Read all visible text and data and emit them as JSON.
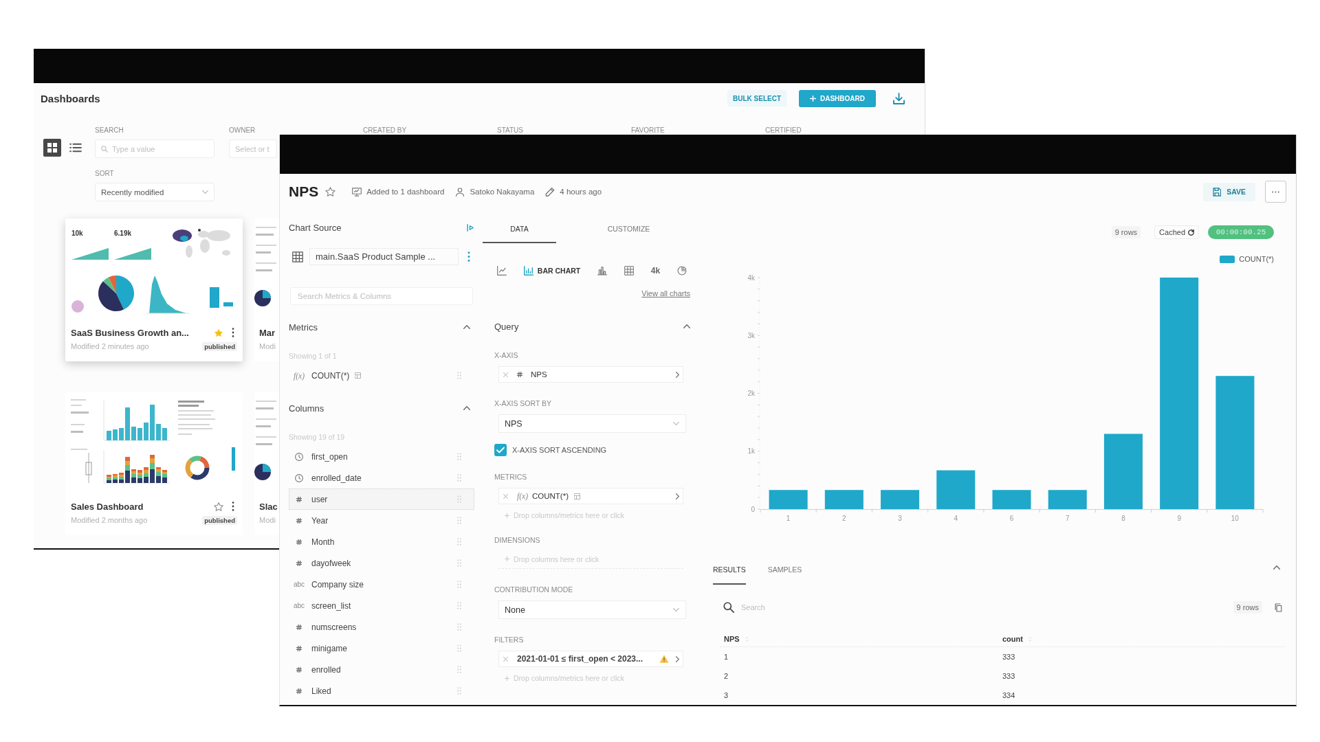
{
  "dashboards_window": {
    "title": "Dashboards",
    "actions": [
      {
        "kind": "secondary",
        "label": "BULK SELECT"
      },
      {
        "kind": "primary",
        "label": "DASHBOARD"
      },
      {
        "kind": "download"
      }
    ],
    "view_modes": [
      {
        "kind": "grid",
        "selected": true
      },
      {
        "kind": "list",
        "selected": false
      }
    ],
    "filters": [
      {
        "label": "SEARCH",
        "kind": "search",
        "placeholder": "Type a value"
      },
      {
        "label": "OWNER",
        "kind": "select",
        "placeholder": "Select or t"
      },
      {
        "label": "CREATED BY"
      },
      {
        "label": "STATUS"
      },
      {
        "label": "FAVORITE"
      },
      {
        "label": "CERTIFIED"
      }
    ],
    "sort": {
      "label": "SORT",
      "value": "Recently modified"
    },
    "cards": [
      {
        "title": "SaaS Business Growth an...",
        "modified": "Modified 2 minutes ago",
        "status": "published",
        "favorite": true,
        "hovered": true,
        "thumbnail": {
          "kind": "kpi_overview",
          "kpis": [
            "10k",
            "6.19k"
          ]
        }
      },
      {
        "title": "Mar",
        "modified": "Modi",
        "hovered": false,
        "thumbnail": {
          "kind": "sliver"
        }
      },
      {
        "title": "Sales Dashboard",
        "modified": "Modified 2 months ago",
        "status": "published",
        "favorite": false,
        "hovered": false,
        "thumbnail": {
          "kind": "sales_overview"
        }
      },
      {
        "title": "Slac",
        "modified": "Modi",
        "hovered": false,
        "thumbnail": {
          "kind": "sliver"
        }
      }
    ]
  },
  "chart_window": {
    "title": "NPS",
    "favorite": false,
    "meta": [
      {
        "kind": "dashboards",
        "text": "Added to 1 dashboard"
      },
      {
        "kind": "owner",
        "text": "Satoko Nakayama"
      },
      {
        "kind": "modified",
        "text": "4 hours ago"
      }
    ],
    "save_label": "SAVE",
    "source_panel": {
      "title": "Chart Source",
      "dataset": "main.SaaS Product Sample ...",
      "search_placeholder": "Search Metrics & Columns",
      "sections": [
        {
          "title": "Metrics",
          "expanded": true,
          "count": "Showing 1 of 1",
          "items": [
            {
              "kind": "metric",
              "type_label": "f(x)",
              "name": "COUNT(*)",
              "hovered": false
            }
          ]
        },
        {
          "title": "Columns",
          "expanded": true,
          "count": "Showing 19 of 19",
          "items": [
            {
              "kind": "temporal",
              "name": "first_open",
              "hovered": false
            },
            {
              "kind": "temporal",
              "name": "enrolled_date",
              "hovered": false
            },
            {
              "kind": "numeric",
              "name": "user",
              "hovered": true
            },
            {
              "kind": "numeric",
              "name": "Year",
              "hovered": false
            },
            {
              "kind": "numeric",
              "name": "Month",
              "hovered": false
            },
            {
              "kind": "numeric",
              "name": "dayofweek",
              "hovered": false
            },
            {
              "kind": "string",
              "type_label": "abc",
              "name": "Company size",
              "hovered": false
            },
            {
              "kind": "string",
              "type_label": "abc",
              "name": "screen_list",
              "hovered": false
            },
            {
              "kind": "numeric",
              "name": "numscreens",
              "hovered": false
            },
            {
              "kind": "numeric",
              "name": "minigame",
              "hovered": false
            },
            {
              "kind": "numeric",
              "name": "enrolled",
              "hovered": false
            },
            {
              "kind": "numeric",
              "name": "Liked",
              "hovered": false
            }
          ]
        }
      ]
    },
    "tabs": [
      {
        "label": "DATA",
        "selected": true
      },
      {
        "label": "CUSTOMIZE",
        "selected": false
      }
    ],
    "chart_types": [
      {
        "kind": "line",
        "selected": false
      },
      {
        "kind": "bar",
        "label": "BAR CHART",
        "selected": true
      },
      {
        "kind": "column",
        "selected": false
      },
      {
        "kind": "table",
        "selected": false
      },
      {
        "kind": "big_number",
        "label": "4k",
        "selected": false
      },
      {
        "kind": "pie",
        "selected": false
      }
    ],
    "view_all_link": "View all charts",
    "query": {
      "title": "Query",
      "expanded": true,
      "controls": [
        {
          "kind": "chips",
          "label": "X-AXIS",
          "chips": [
            {
              "kind": "numeric",
              "text": "NPS",
              "warning": false
            }
          ]
        },
        {
          "kind": "select",
          "label": "X-AXIS SORT BY",
          "value": "NPS"
        },
        {
          "kind": "checkbox",
          "label": "X-AXIS SORT ASCENDING",
          "checked": true
        },
        {
          "kind": "chips",
          "label": "METRICS",
          "chips": [
            {
              "kind": "metric",
              "type_label": "f(x)",
              "text": "COUNT(*)",
              "warning": false
            }
          ],
          "hint": "Drop columns/metrics here or click"
        },
        {
          "kind": "chips",
          "label": "DIMENSIONS",
          "hint": "Drop columns here or click"
        },
        {
          "kind": "select",
          "label": "CONTRIBUTION MODE",
          "value": "None"
        },
        {
          "kind": "chips",
          "label": "FILTERS",
          "chips": [
            {
              "kind": "filter",
              "text": "2021-01-01 ≤ first_open < 2023...",
              "warning": true
            }
          ],
          "hint": "Drop columns/metrics here or click"
        }
      ]
    },
    "chart_panel": {
      "row_count": "9 rows",
      "cache_label": "Cached",
      "duration": "00:00:00.25",
      "chart_data": {
        "type": "bar",
        "categories": [
          "1",
          "2",
          "3",
          "4",
          "6",
          "7",
          "8",
          "9",
          "10"
        ],
        "series": [
          {
            "name": "COUNT(*)",
            "color": "#1fa8c9",
            "values": [
              330,
              330,
              330,
              670,
              330,
              330,
              1300,
              4000,
              2300
            ]
          }
        ],
        "ylim": [
          0,
          4000
        ],
        "yticks": [
          {
            "value": 0,
            "label": "0"
          },
          {
            "value": 1000,
            "label": "1k"
          },
          {
            "value": 2000,
            "label": "2k"
          },
          {
            "value": 3000,
            "label": "3k"
          },
          {
            "value": 4000,
            "label": "4k"
          }
        ]
      }
    },
    "results": {
      "expanded": true,
      "tabs": [
        {
          "label": "RESULTS",
          "selected": true
        },
        {
          "label": "SAMPLES",
          "selected": false
        }
      ],
      "search_placeholder": "Search",
      "row_count": "9 rows",
      "columns": [
        "NPS",
        "count"
      ],
      "rows": [
        [
          "1",
          "333"
        ],
        [
          "2",
          "333"
        ],
        [
          "3",
          "334"
        ]
      ]
    }
  }
}
